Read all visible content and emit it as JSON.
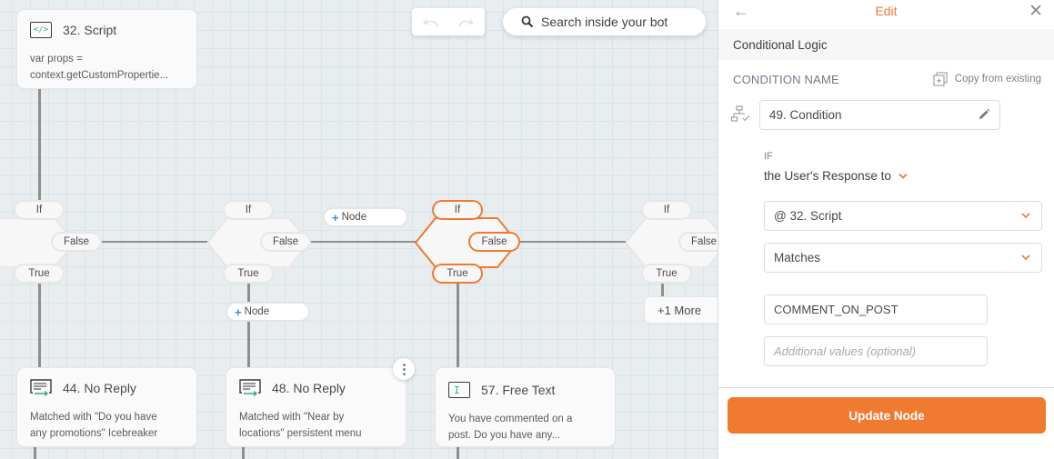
{
  "canvas": {
    "toolbar": {
      "undo_icon": "undo-icon",
      "redo_icon": "redo-icon",
      "search_label": "Search inside your bot",
      "search_icon": "search-icon"
    },
    "nodes": [
      {
        "id": "script-32",
        "icon": "code-icon",
        "icon_glyph": "</>",
        "title": "32. Script",
        "body": [
          "var props =",
          "context.getCustomPropertie..."
        ]
      },
      {
        "id": "noreply-44",
        "icon": "message-reply-icon",
        "title": "44. No Reply",
        "body": [
          "Matched with \"Do you have",
          "any promotions\" Icebreaker"
        ]
      },
      {
        "id": "noreply-48",
        "icon": "message-reply-icon",
        "title": "48. No Reply",
        "body": [
          "Matched with \"Near by",
          "locations\" persistent menu"
        ]
      },
      {
        "id": "freetext-57",
        "icon": "text-cursor-icon",
        "icon_glyph": "I",
        "title": "57. Free Text",
        "body": [
          "You have commented on a",
          "post. Do you have any..."
        ]
      }
    ],
    "conditions": [
      {
        "if_label": "If",
        "false_label": "False",
        "true_label": "True",
        "active": false
      },
      {
        "if_label": "If",
        "false_label": "False",
        "true_label": "True",
        "active": false
      },
      {
        "if_label": "If",
        "false_label": "False",
        "true_label": "True",
        "active": true
      },
      {
        "if_label": "If",
        "false_label": "False",
        "true_label": "True",
        "active": false
      }
    ],
    "add_node_label": "Node",
    "more_label": "+1 More"
  },
  "panel": {
    "title": "Edit",
    "subtitle": "Conditional Logic",
    "condition_name_label": "CONDITION NAME",
    "copy_from_existing": "Copy from existing",
    "condition_name_value": "49. Condition",
    "if_label": "IF",
    "source_label": "the User's Response to",
    "source_select": "@ 32. Script",
    "operator_select": "Matches",
    "value_input": "COMMENT_ON_POST",
    "additional_placeholder": "Additional values (optional)",
    "update_button": "Update Node",
    "accent_color": "#f07a30"
  }
}
